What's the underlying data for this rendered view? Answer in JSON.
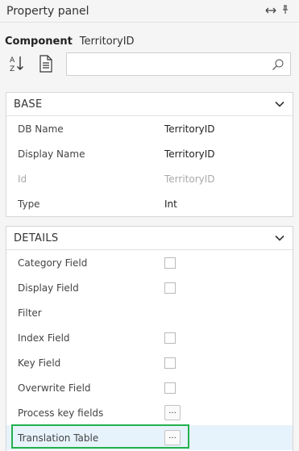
{
  "panel": {
    "title": "Property panel",
    "pin_icon": "pin-icon",
    "resize_icon": "horizontal-resize-icon"
  },
  "component": {
    "label": "Component",
    "value": "TerritoryID"
  },
  "toolbar": {
    "sort_icon": "sort-az-icon",
    "pages_icon": "property-pages-icon"
  },
  "search": {
    "value": "",
    "placeholder": "",
    "icon": "search-icon"
  },
  "base": {
    "header": "BASE",
    "rows": [
      {
        "name": "DB Name",
        "value": "TerritoryID"
      },
      {
        "name": "Display Name",
        "value": "TerritoryID"
      },
      {
        "name": "Id",
        "value": "TerritoryID"
      },
      {
        "name": "Type",
        "value": "Int"
      }
    ]
  },
  "details": {
    "header": "DETAILS",
    "rows": [
      {
        "name": "Category Field",
        "control": "checkbox",
        "checked": false
      },
      {
        "name": "Display Field",
        "control": "checkbox",
        "checked": false
      },
      {
        "name": "Filter",
        "control": "none"
      },
      {
        "name": "Index Field",
        "control": "checkbox",
        "checked": false
      },
      {
        "name": "Key Field",
        "control": "checkbox",
        "checked": false
      },
      {
        "name": "Overwrite Field",
        "control": "checkbox",
        "checked": false
      },
      {
        "name": "Process key fields",
        "control": "ellipsis",
        "button_label": "..."
      },
      {
        "name": "Translation Table",
        "control": "ellipsis",
        "button_label": "..."
      }
    ]
  },
  "colors": {
    "highlight": "#22b14c",
    "selected_row": "#e7f3fc"
  }
}
